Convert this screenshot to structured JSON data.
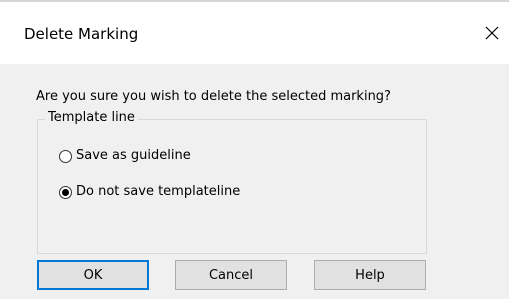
{
  "window": {
    "title": "Delete Marking",
    "close_icon": "close-icon"
  },
  "content": {
    "question": "Are you sure you wish to delete the selected marking?",
    "group_title": "Template line",
    "options": [
      {
        "label": "Save as guideline",
        "selected": false
      },
      {
        "label": "Do not save templateline",
        "selected": true
      }
    ]
  },
  "buttons": {
    "ok": "OK",
    "cancel": "Cancel",
    "help": "Help"
  }
}
